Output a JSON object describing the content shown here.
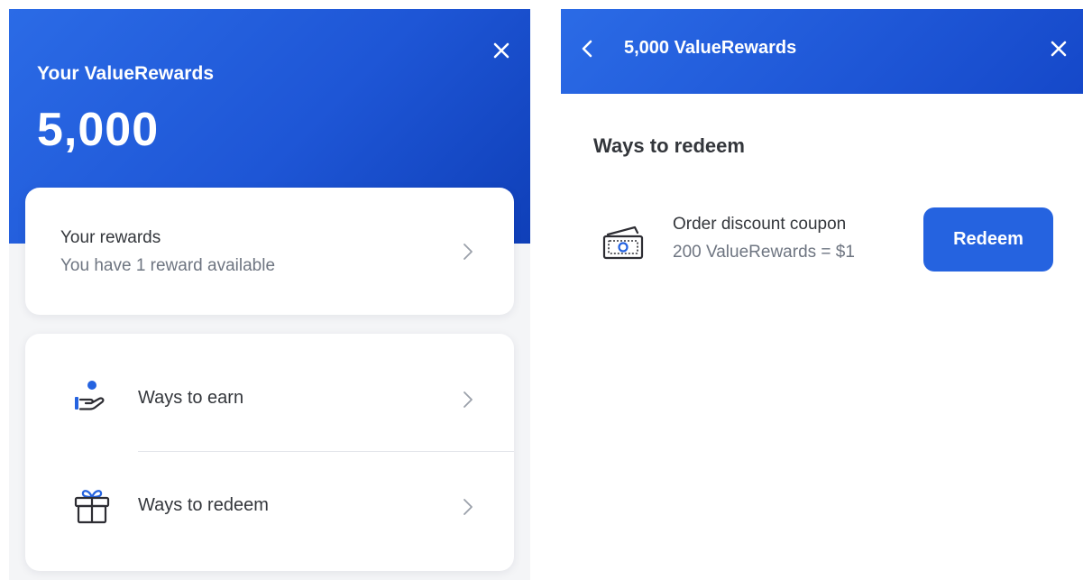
{
  "left": {
    "title": "Your ValueRewards",
    "points": "5,000",
    "rewards_card": {
      "title": "Your rewards",
      "subtitle": "You have 1 reward available"
    },
    "menu": [
      {
        "label": "Ways to earn",
        "icon": "hand-coin-icon"
      },
      {
        "label": "Ways to redeem",
        "icon": "gift-icon"
      }
    ]
  },
  "right": {
    "header_title": "5,000 ValueRewards",
    "section_title": "Ways to redeem",
    "coupon": {
      "title": "Order discount coupon",
      "subtitle": "200 ValueRewards = $1",
      "icon": "cash-icon",
      "button_label": "Redeem"
    }
  },
  "colors": {
    "brand_blue": "#2563e0",
    "header_gradient_start": "#2b6be6",
    "header_gradient_end": "#0f3fb8",
    "text_primary": "#33363b",
    "text_secondary": "#6e7581"
  }
}
